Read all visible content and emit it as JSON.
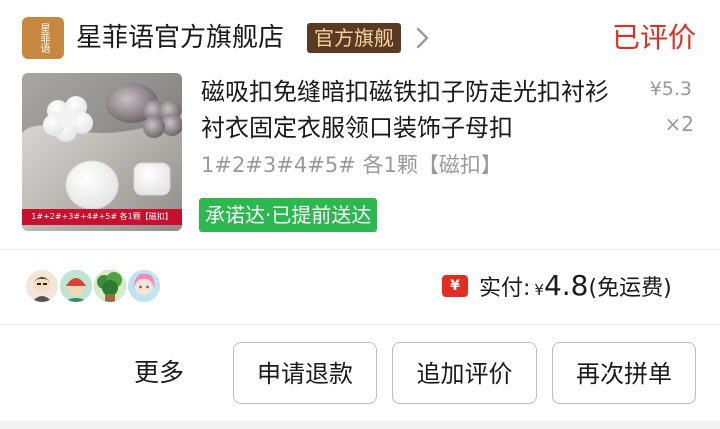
{
  "store": {
    "logo_text": "星菲语",
    "name": "星菲语官方旗舰店",
    "badge": "官方旗舰",
    "chevron_icon": "chevron-right-icon"
  },
  "order": {
    "status": "已评价"
  },
  "product": {
    "title": "磁吸扣免缝暗扣磁铁扣子防走光扣衬衫衬衣固定衣服领口装饰子母扣",
    "thumb_caption": "1#+2#+3#+4#+5# 各1颗【磁扣】",
    "price": "¥5.3",
    "quantity": "×2",
    "variant": "1#2#3#4#5# 各1颗【磁扣】",
    "delivery_tag": "承诺达·已提前送达"
  },
  "payment": {
    "icon": "yen-icon",
    "label": "实付:",
    "currency": "¥",
    "amount": "4.8",
    "note": "(免运费)"
  },
  "actions": {
    "more": "更多",
    "refund": "申请退款",
    "add_review": "追加评价",
    "rebuy": "再次拼单"
  },
  "colors": {
    "accent": "#e02e24",
    "badge_bg": "#5b3a23",
    "badge_text": "#f5d49c",
    "delivery_green": "#2db84f",
    "muted": "#999999"
  }
}
